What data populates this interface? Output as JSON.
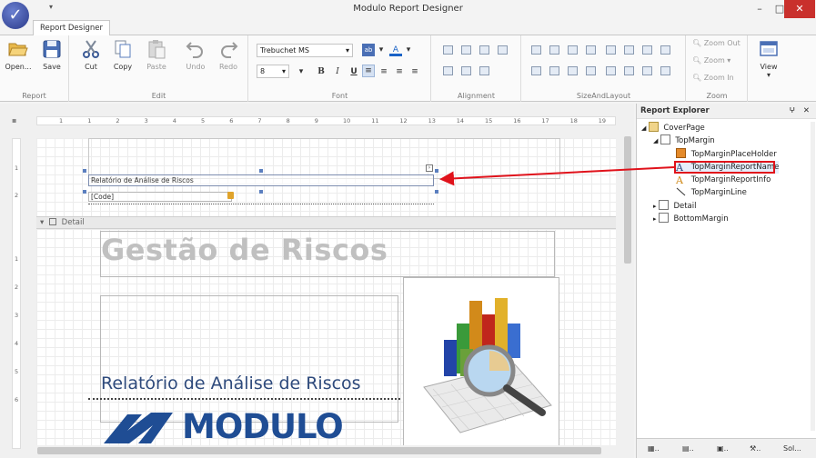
{
  "window": {
    "title": "Modulo Report Designer",
    "tab": "Report Designer",
    "minimize_glyph": "–",
    "maximize_glyph": "□",
    "close_glyph": "✕",
    "qat_glyph": "▾"
  },
  "ribbon": {
    "groups": {
      "report": "Report",
      "edit": "Edit",
      "font": "Font",
      "alignment": "Alignment",
      "size": "SizeAndLayout",
      "zoom": "Zoom"
    },
    "buttons": {
      "open": "Open...",
      "save": "Save",
      "cut": "Cut",
      "copy": "Copy",
      "paste": "Paste",
      "undo": "Undo",
      "redo": "Redo",
      "view": "View"
    },
    "font": {
      "family": "Trebuchet MS",
      "size": "8",
      "bold": "B",
      "italic": "I",
      "underline": "U"
    },
    "zoom": {
      "zoom_out": "Zoom Out",
      "zoom": "Zoom",
      "zoom_in": "Zoom In"
    }
  },
  "ruler": {
    "h_ticks": [
      "1",
      "1",
      "2",
      "3",
      "4",
      "5",
      "6",
      "7",
      "8",
      "9",
      "10",
      "11",
      "12",
      "13",
      "14",
      "15",
      "16",
      "17",
      "18",
      "19"
    ],
    "v_ticks_top": [
      "1",
      "2"
    ],
    "v_ticks_detail": [
      "1",
      "2",
      "3",
      "4",
      "5",
      "6"
    ]
  },
  "designer": {
    "detail_band": "Detail",
    "header_name": "Relatório de Análise de Riscos",
    "header_code": "[Code]",
    "title_text": "Gestão de Riscos",
    "subtitle_text": "Relatório de Análise de Riscos",
    "logo_text": "MODULO"
  },
  "explorer": {
    "title": "Report Explorer",
    "pin": "ⵖ",
    "close": "✕",
    "nodes": [
      "CoverPage",
      "TopMargin",
      "TopMarginPlaceHolder",
      "TopMarginReportName",
      "TopMarginReportInfo",
      "TopMarginLine",
      "Detail",
      "BottomMargin"
    ],
    "footer_tabs": [
      "..",
      "..",
      "..",
      "..",
      "Sol..."
    ]
  }
}
